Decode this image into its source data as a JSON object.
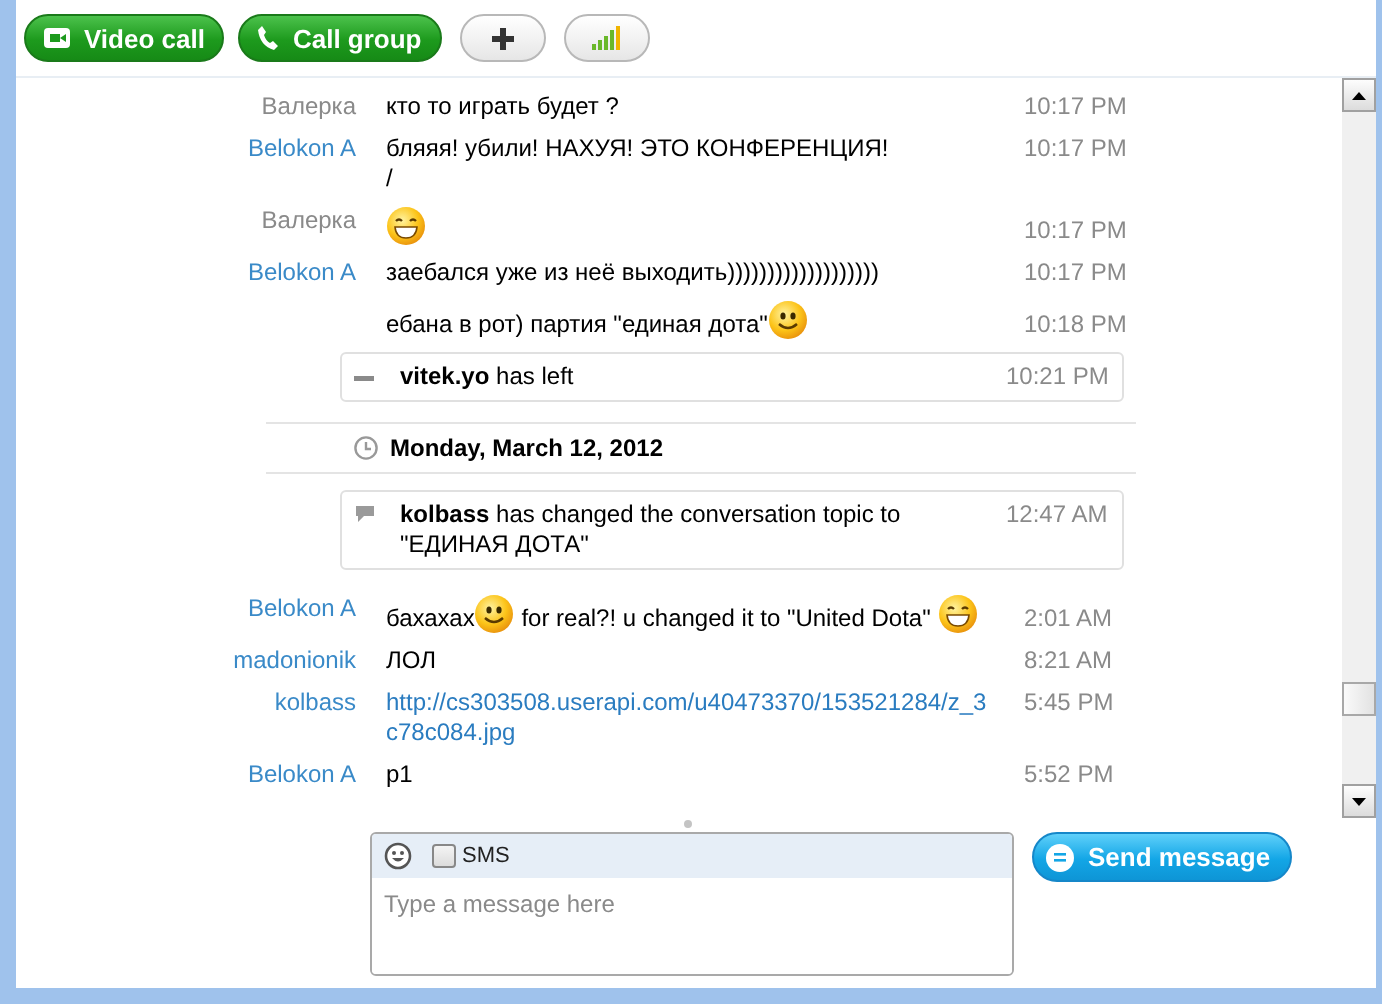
{
  "toolbar": {
    "buttons": [
      {
        "kind": "video",
        "label": "Video call"
      },
      {
        "kind": "call",
        "label": "Call group"
      },
      {
        "kind": "add"
      },
      {
        "kind": "signal"
      }
    ]
  },
  "chat": {
    "items": [
      {
        "kind": "message",
        "sender": "Валерка",
        "color": "#8a8a8a",
        "parts": [
          {
            "kind": "text",
            "text": "кто то играть будет ?"
          }
        ],
        "time": "10:17 PM"
      },
      {
        "kind": "message",
        "sender": "Belokon A",
        "color": "#3a8ac8",
        "parts": [
          {
            "kind": "text",
            "text": "бляяя! убили! НАХУЯ! ЭТО КОНФЕРЕНЦИЯ!\n/"
          }
        ],
        "time": "10:17 PM"
      },
      {
        "kind": "message",
        "sender": "Валерка",
        "color": "#8a8a8a",
        "parts": [
          {
            "kind": "grin"
          }
        ],
        "time": "10:17 PM"
      },
      {
        "kind": "message",
        "sender": "Belokon A",
        "color": "#3a8ac8",
        "parts": [
          {
            "kind": "text",
            "text": "заебался уже из неё выходить)))))))))))))))))))"
          }
        ],
        "time": "10:17 PM"
      },
      {
        "kind": "message",
        "parts": [
          {
            "kind": "text",
            "text": "ебана в рот) партия \"единая дота\""
          },
          {
            "kind": "smile"
          }
        ],
        "time": "10:18 PM"
      },
      {
        "kind": "left",
        "user": "vitek.yo",
        "text": "has left",
        "time": "10:21 PM"
      },
      {
        "kind": "date",
        "text": "Monday, March 12, 2012"
      },
      {
        "kind": "topic",
        "user": "kolbass",
        "text": "has changed the conversation topic to \"ЕДИНАЯ ДОТА\"",
        "time": "12:47 AM"
      },
      {
        "kind": "message",
        "sender": "Belokon A",
        "color": "#3a8ac8",
        "parts": [
          {
            "kind": "text",
            "text": "бахахах"
          },
          {
            "kind": "smile"
          },
          {
            "kind": "text",
            "text": " for real?! u changed it to \"United Dota\" "
          },
          {
            "kind": "grin"
          }
        ],
        "time": "2:01 AM"
      },
      {
        "kind": "message",
        "sender": "madonionik",
        "color": "#3a8ac8",
        "parts": [
          {
            "kind": "text",
            "text": "ЛОЛ"
          }
        ],
        "time": "8:21 AM"
      },
      {
        "kind": "message",
        "sender": "kolbass",
        "color": "#3a8ac8",
        "parts": [
          {
            "kind": "link",
            "text": "http://cs303508.userapi.com/u40473370/153521284/z_3c78c084.jpg"
          }
        ],
        "time": "5:45 PM"
      },
      {
        "kind": "message",
        "sender": "Belokon A",
        "color": "#3a8ac8",
        "parts": [
          {
            "kind": "text",
            "text": "p1"
          }
        ],
        "time": "5:52 PM"
      }
    ]
  },
  "composer": {
    "sms": {
      "label": "SMS",
      "checked": false
    },
    "placeholder": "Type a message here",
    "send_button": "Send message"
  }
}
